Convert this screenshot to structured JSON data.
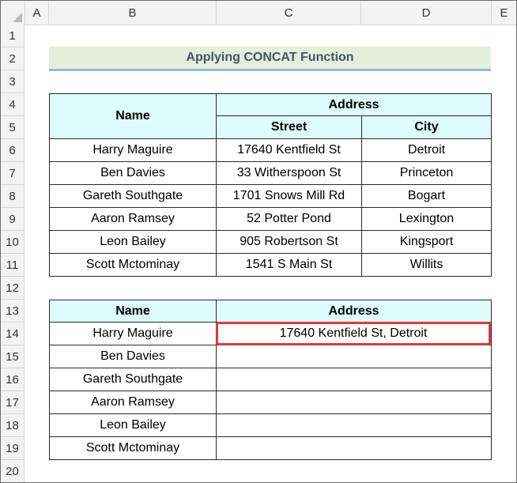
{
  "sheet": {
    "columns": [
      "A",
      "B",
      "C",
      "D",
      "E"
    ],
    "rows": [
      "1",
      "2",
      "3",
      "4",
      "5",
      "6",
      "7",
      "8",
      "9",
      "10",
      "11",
      "12",
      "13",
      "14",
      "15",
      "16",
      "17",
      "18",
      "19",
      "20"
    ]
  },
  "title": "Applying CONCAT Function",
  "table1": {
    "header_name": "Name",
    "header_address": "Address",
    "header_street": "Street",
    "header_city": "City",
    "rows": [
      {
        "name": "Harry Maguire",
        "street": "17640 Kentfield St",
        "city": "Detroit"
      },
      {
        "name": "Ben Davies",
        "street": "33 Witherspoon St",
        "city": "Princeton"
      },
      {
        "name": "Gareth Southgate",
        "street": "1701 Snows Mill Rd",
        "city": "Bogart"
      },
      {
        "name": "Aaron Ramsey",
        "street": "52 Potter Pond",
        "city": "Lexington"
      },
      {
        "name": "Leon Bailey",
        "street": "905 Robertson St",
        "city": "Kingsport"
      },
      {
        "name": "Scott Mctominay",
        "street": "1541 S Main St",
        "city": "Willits"
      }
    ]
  },
  "table2": {
    "header_name": "Name",
    "header_address": "Address",
    "rows": [
      {
        "name": "Harry Maguire",
        "address": "17640 Kentfield St, Detroit"
      },
      {
        "name": "Ben Davies",
        "address": ""
      },
      {
        "name": "Gareth Southgate",
        "address": ""
      },
      {
        "name": "Aaron Ramsey",
        "address": ""
      },
      {
        "name": "Leon Bailey",
        "address": ""
      },
      {
        "name": "Scott Mctominay",
        "address": ""
      }
    ]
  },
  "colors": {
    "title_fill": "#e2efda",
    "header_fill": "#ddfbfb",
    "highlight_border": "#e03a3a"
  }
}
